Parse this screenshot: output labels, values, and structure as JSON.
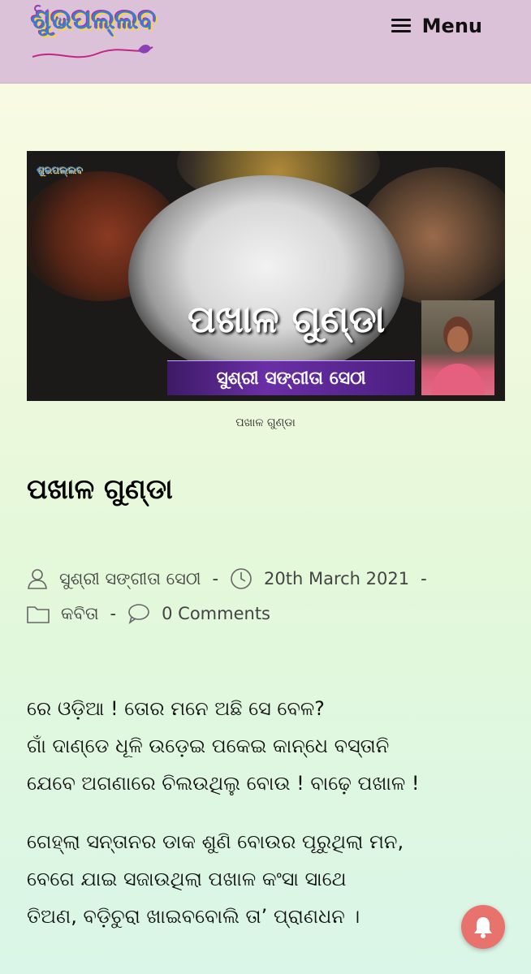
{
  "header": {
    "logo_text": "ଶୁଭପଲ୍ଲବ",
    "menu_label": "Menu"
  },
  "featured_image": {
    "title_overlay": "ପଖାଳ ଗୁଣ୍ଡା",
    "author_overlay": "ସୁଶ୍ରୀ ସଙ୍ଗୀତା ସେଠୀ",
    "corner_logo": "ଶୁଭପଲ୍ଲବ",
    "caption": "ପଖାଳ ଗୁଣ୍ଡା"
  },
  "post": {
    "title": "ପଖାଳ ଗୁଣ୍ଡା",
    "author": "ସୁଶ୍ରୀ ସଙ୍ଗୀତା ସେଠୀ",
    "date": "20th March 2021",
    "category": "କବିତା",
    "comments": "0 Comments",
    "separator": "-",
    "paragraphs": [
      {
        "lines": [
          "ରେ ଓଡ଼ିଆ ! ତୋର ମନେ ଅଛି ସେ ବେଳ?",
          "ଗାଁ ଦାଣ୍ଡେ ଧୂଳି ଉଡ଼େଇ ପକେଇ କାନ୍ଧେ ବସ୍ତାନି",
          "ଯେବେ ଅଗଣାରେ ଚିଲଉଥିଲୁ ବୋଉ ! ବାଢ଼େ ପଖାଳ !"
        ]
      },
      {
        "lines": [
          "ଗେହ୍ଲା ସନ୍ତାନର ଡାକ ଶୁଣି ବୋଉର ପୂରୁଥିଲା ମନ,",
          "ବେଗେ ଯାଇ ସଜାଉଥିଲା ପଖାଳ କଂସା ସାଥେ",
          "ତିଅଣ, ବଡ଼ିଚୁରା ଖାଇବବୋଲି ତା’ ପ୍ରାଣଧନ ।"
        ]
      }
    ]
  },
  "colors": {
    "header_bg": "#dcc2d8",
    "overlay_bar": "#6a2fa6",
    "notification_bell_bg": "#e8736c"
  }
}
